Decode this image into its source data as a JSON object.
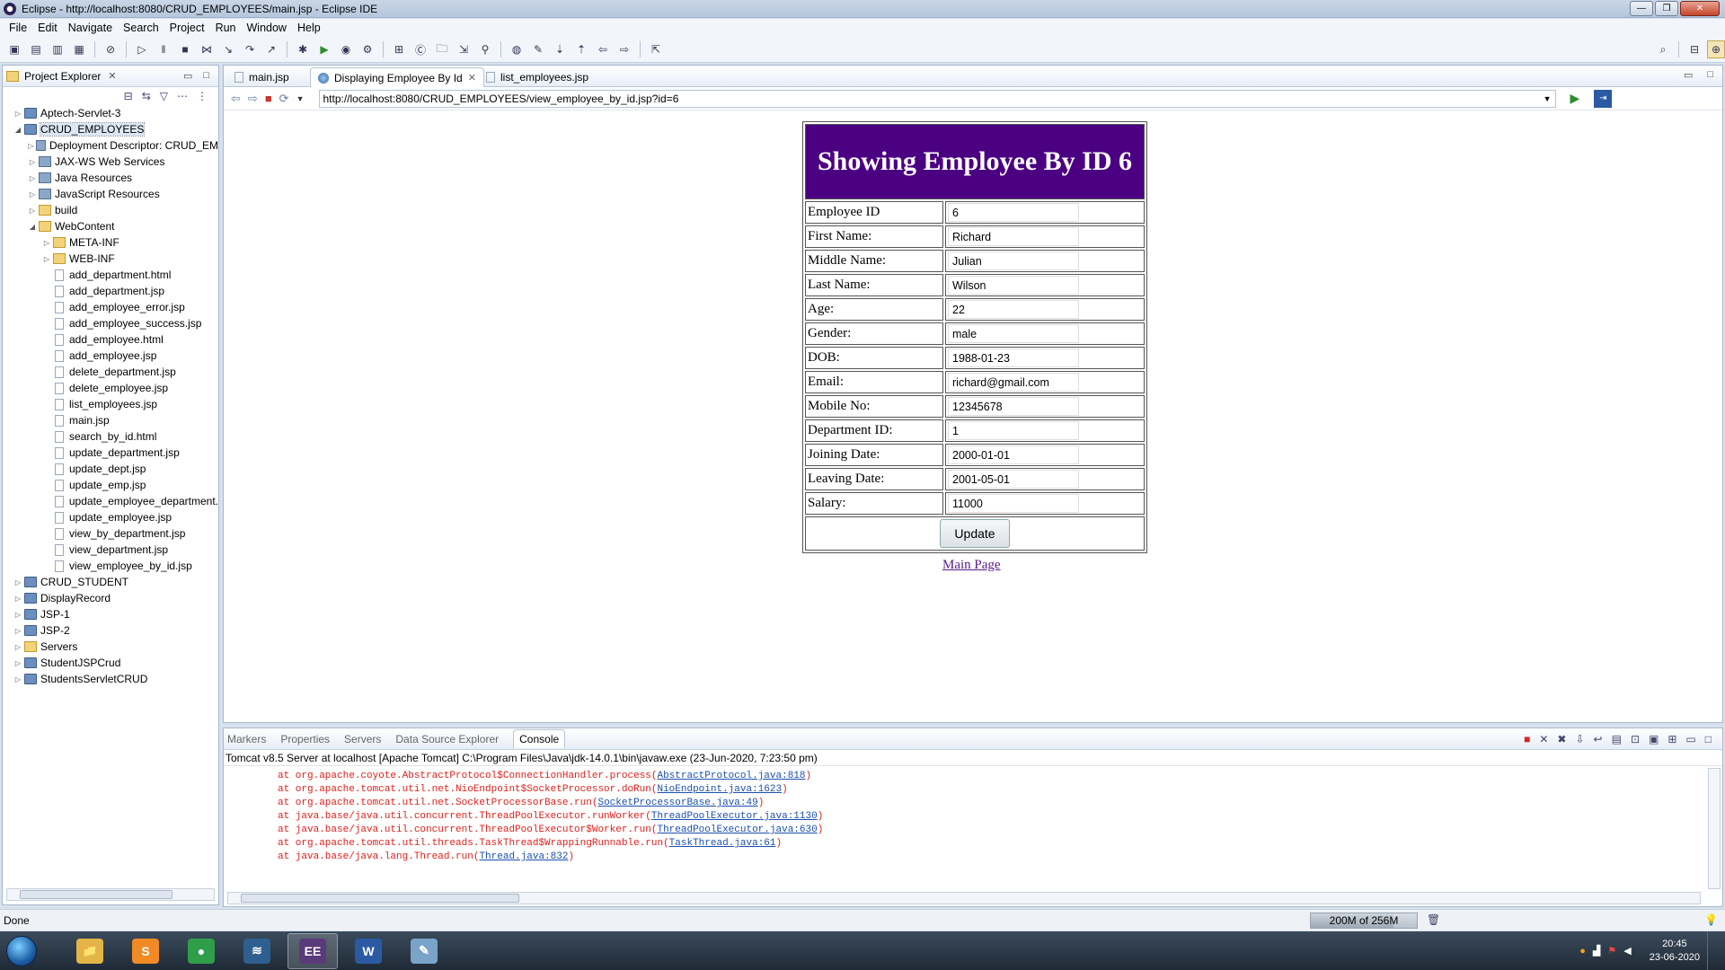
{
  "window": {
    "title": "Eclipse - http://localhost:8080/CRUD_EMPLOYEES/main.jsp - Eclipse IDE"
  },
  "menu": [
    "File",
    "Edit",
    "Navigate",
    "Search",
    "Project",
    "Run",
    "Window",
    "Help"
  ],
  "project_explorer": {
    "title": "Project Explorer",
    "items": [
      {
        "label": "Aptech-Servlet-3",
        "type": "project",
        "level": 0,
        "twisty": "▷"
      },
      {
        "label": "CRUD_EMPLOYEES",
        "type": "project",
        "level": 0,
        "twisty": "◢",
        "selected": true
      },
      {
        "label": "Deployment Descriptor: CRUD_EM",
        "type": "misc",
        "level": 1,
        "twisty": "▷"
      },
      {
        "label": "JAX-WS Web Services",
        "type": "misc",
        "level": 1,
        "twisty": "▷"
      },
      {
        "label": "Java Resources",
        "type": "misc",
        "level": 1,
        "twisty": "▷"
      },
      {
        "label": "JavaScript Resources",
        "type": "misc",
        "level": 1,
        "twisty": "▷"
      },
      {
        "label": "build",
        "type": "folder",
        "level": 1,
        "twisty": "▷"
      },
      {
        "label": "WebContent",
        "type": "folder",
        "level": 1,
        "twisty": "◢"
      },
      {
        "label": "META-INF",
        "type": "folder",
        "level": 2,
        "twisty": "▷"
      },
      {
        "label": "WEB-INF",
        "type": "folder",
        "level": 2,
        "twisty": "▷"
      },
      {
        "label": "add_department.html",
        "type": "file",
        "level": 2,
        "twisty": ""
      },
      {
        "label": "add_department.jsp",
        "type": "file",
        "level": 2,
        "twisty": ""
      },
      {
        "label": "add_employee_error.jsp",
        "type": "file",
        "level": 2,
        "twisty": ""
      },
      {
        "label": "add_employee_success.jsp",
        "type": "file",
        "level": 2,
        "twisty": ""
      },
      {
        "label": "add_employee.html",
        "type": "file",
        "level": 2,
        "twisty": ""
      },
      {
        "label": "add_employee.jsp",
        "type": "file",
        "level": 2,
        "twisty": ""
      },
      {
        "label": "delete_department.jsp",
        "type": "file",
        "level": 2,
        "twisty": ""
      },
      {
        "label": "delete_employee.jsp",
        "type": "file",
        "level": 2,
        "twisty": ""
      },
      {
        "label": "list_employees.jsp",
        "type": "file",
        "level": 2,
        "twisty": ""
      },
      {
        "label": "main.jsp",
        "type": "file",
        "level": 2,
        "twisty": ""
      },
      {
        "label": "search_by_id.html",
        "type": "file",
        "level": 2,
        "twisty": ""
      },
      {
        "label": "update_department.jsp",
        "type": "file",
        "level": 2,
        "twisty": ""
      },
      {
        "label": "update_dept.jsp",
        "type": "file",
        "level": 2,
        "twisty": ""
      },
      {
        "label": "update_emp.jsp",
        "type": "file",
        "level": 2,
        "twisty": ""
      },
      {
        "label": "update_employee_department.",
        "type": "file",
        "level": 2,
        "twisty": ""
      },
      {
        "label": "update_employee.jsp",
        "type": "file",
        "level": 2,
        "twisty": ""
      },
      {
        "label": "view_by_department.jsp",
        "type": "file",
        "level": 2,
        "twisty": ""
      },
      {
        "label": "view_department.jsp",
        "type": "file",
        "level": 2,
        "twisty": ""
      },
      {
        "label": "view_employee_by_id.jsp",
        "type": "file",
        "level": 2,
        "twisty": ""
      },
      {
        "label": "CRUD_STUDENT",
        "type": "project",
        "level": 0,
        "twisty": "▷"
      },
      {
        "label": "DisplayRecord",
        "type": "project",
        "level": 0,
        "twisty": "▷"
      },
      {
        "label": "JSP-1",
        "type": "project",
        "level": 0,
        "twisty": "▷"
      },
      {
        "label": "JSP-2",
        "type": "project",
        "level": 0,
        "twisty": "▷"
      },
      {
        "label": "Servers",
        "type": "folder",
        "level": 0,
        "twisty": "▷"
      },
      {
        "label": "StudentJSPCrud",
        "type": "project",
        "level": 0,
        "twisty": "▷"
      },
      {
        "label": "StudentsServletCRUD",
        "type": "project",
        "level": 0,
        "twisty": "▷"
      }
    ]
  },
  "editor": {
    "tabs": [
      "main.jsp",
      "Displaying Employee By Id",
      "list_employees.jsp"
    ],
    "active_tab": 1,
    "url": "http://localhost:8080/CRUD_EMPLOYEES/view_employee_by_id.jsp?id=6"
  },
  "webpage": {
    "heading": "Showing Employee By ID 6",
    "fields": [
      {
        "label": "Employee ID",
        "value": "6"
      },
      {
        "label": "First Name:",
        "value": "Richard"
      },
      {
        "label": "Middle Name:",
        "value": "Julian"
      },
      {
        "label": "Last Name:",
        "value": "Wilson"
      },
      {
        "label": "Age:",
        "value": "22"
      },
      {
        "label": "Gender:",
        "value": "male"
      },
      {
        "label": "DOB:",
        "value": "1988-01-23"
      },
      {
        "label": "Email:",
        "value": "richard@gmail.com"
      },
      {
        "label": "Mobile No:",
        "value": "12345678"
      },
      {
        "label": "Department ID:",
        "value": "1"
      },
      {
        "label": "Joining Date:",
        "value": "2000-01-01"
      },
      {
        "label": "Leaving Date:",
        "value": "2001-05-01"
      },
      {
        "label": "Salary:",
        "value": "11000"
      }
    ],
    "update_button": "Update",
    "main_link": "Main Page"
  },
  "console": {
    "tabs": [
      "Markers",
      "Properties",
      "Servers",
      "Data Source Explorer",
      "Console"
    ],
    "active_tab": 4,
    "description": "Tomcat v8.5 Server at localhost [Apache Tomcat] C:\\Program Files\\Java\\jdk-14.0.1\\bin\\javaw.exe (23-Jun-2020, 7:23:50 pm)",
    "lines": [
      {
        "text": "at org.apache.coyote.AbstractProtocol$ConnectionHandler.process(",
        "link": "AbstractProtocol.java:818",
        "end": ")"
      },
      {
        "text": "at org.apache.tomcat.util.net.NioEndpoint$SocketProcessor.doRun(",
        "link": "NioEndpoint.java:1623",
        "end": ")"
      },
      {
        "text": "at org.apache.tomcat.util.net.SocketProcessorBase.run(",
        "link": "SocketProcessorBase.java:49",
        "end": ")"
      },
      {
        "text": "at java.base/java.util.concurrent.ThreadPoolExecutor.runWorker(",
        "link": "ThreadPoolExecutor.java:1130",
        "end": ")"
      },
      {
        "text": "at java.base/java.util.concurrent.ThreadPoolExecutor$Worker.run(",
        "link": "ThreadPoolExecutor.java:630",
        "end": ")"
      },
      {
        "text": "at org.apache.tomcat.util.threads.TaskThread$WrappingRunnable.run(",
        "link": "TaskThread.java:61",
        "end": ")"
      },
      {
        "text": "at java.base/java.lang.Thread.run(",
        "link": "Thread.java:832",
        "end": ")"
      }
    ]
  },
  "status": {
    "text": "Done",
    "heap": "200M of 256M",
    "heap_used_fraction": 0.78
  },
  "taskbar": {
    "apps": [
      {
        "name": "explorer-icon",
        "glyph": "📁",
        "color": "#e3b548"
      },
      {
        "name": "sublime-icon",
        "glyph": "S",
        "color": "#f08a24"
      },
      {
        "name": "chrome-icon",
        "glyph": "●",
        "color": "#2e9e48"
      },
      {
        "name": "mysql-workbench-icon",
        "glyph": "≋",
        "color": "#2f5f8f"
      },
      {
        "name": "eclipse-icon",
        "glyph": "EE",
        "color": "#5a3a7a"
      },
      {
        "name": "word-icon",
        "glyph": "W",
        "color": "#2b5aa3"
      },
      {
        "name": "paint-icon",
        "glyph": "✎",
        "color": "#7aa3c8"
      }
    ],
    "active_index": 4,
    "time": "20:45",
    "date": "23-06-2020"
  },
  "colors": {
    "heading_bg": "#4b0082",
    "console_error": "#e0201c",
    "link": "#551a8b"
  }
}
